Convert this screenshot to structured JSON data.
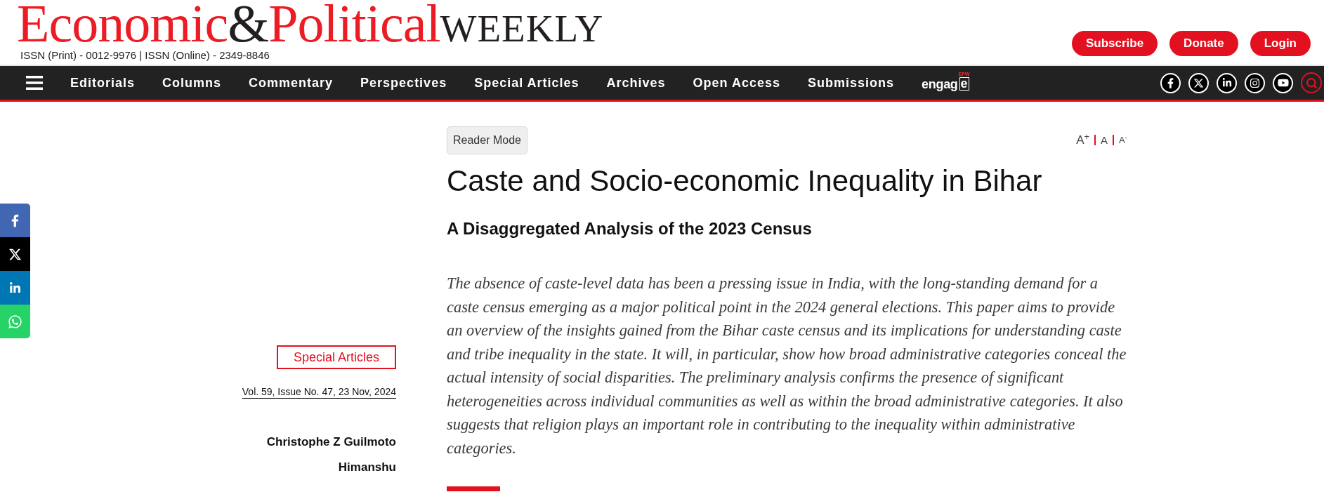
{
  "header": {
    "logo": [
      {
        "text": "Economic",
        "kind": "accent"
      },
      {
        "text": "&",
        "kind": "dark"
      },
      {
        "text": "Political",
        "kind": "accent"
      },
      {
        "text": "WEEKLY",
        "kind": "caps"
      }
    ],
    "issn": "ISSN (Print) - 0012-9976 | ISSN (Online) - 2349-8846",
    "buttons": [
      "Subscribe",
      "Donate",
      "Login"
    ]
  },
  "nav": {
    "items": [
      "Editorials",
      "Columns",
      "Commentary",
      "Perspectives",
      "Special Articles",
      "Archives",
      "Open Access",
      "Submissions"
    ],
    "logo": {
      "word": "engag",
      "boxed_letter": "e",
      "tag": "EPW"
    }
  },
  "article": {
    "reader_mode": "Reader Mode",
    "font_size_controls": [
      {
        "kind": "increase",
        "label": "A$^{+}$"
      },
      {
        "kind": "reset",
        "label": "A"
      },
      {
        "kind": "decrease",
        "label": "A$^{-}$"
      }
    ],
    "title": "Caste and Socio-economic Inequality in Bihar",
    "subtitle": "A Disaggregated Analysis of the 2023 Census",
    "abstract": "The absence of caste-level data has been a pressing issue in India, with the long-standing demand for a caste census emerging as a major political point in the 2024 general elections. This paper aims to provide an overview of the insights gained from the Bihar caste census and its implications for understanding caste and tribe inequality in the state. It will, in particular, show how broad administrative categories conceal the actual intensity of social disparities. The preliminary analysis confirms the presence of significant heterogeneities across individual communities as well as within the broad administrative categories. It also suggests that religion plays an important role in contributing to the inequality within administrative categories."
  },
  "article_meta": {
    "section": "Special Articles",
    "issue": "Vol. 59, Issue No. 47, 23 Nov, 2024",
    "authors": [
      "Christophe Z Guilmoto",
      "Himanshu"
    ]
  }
}
